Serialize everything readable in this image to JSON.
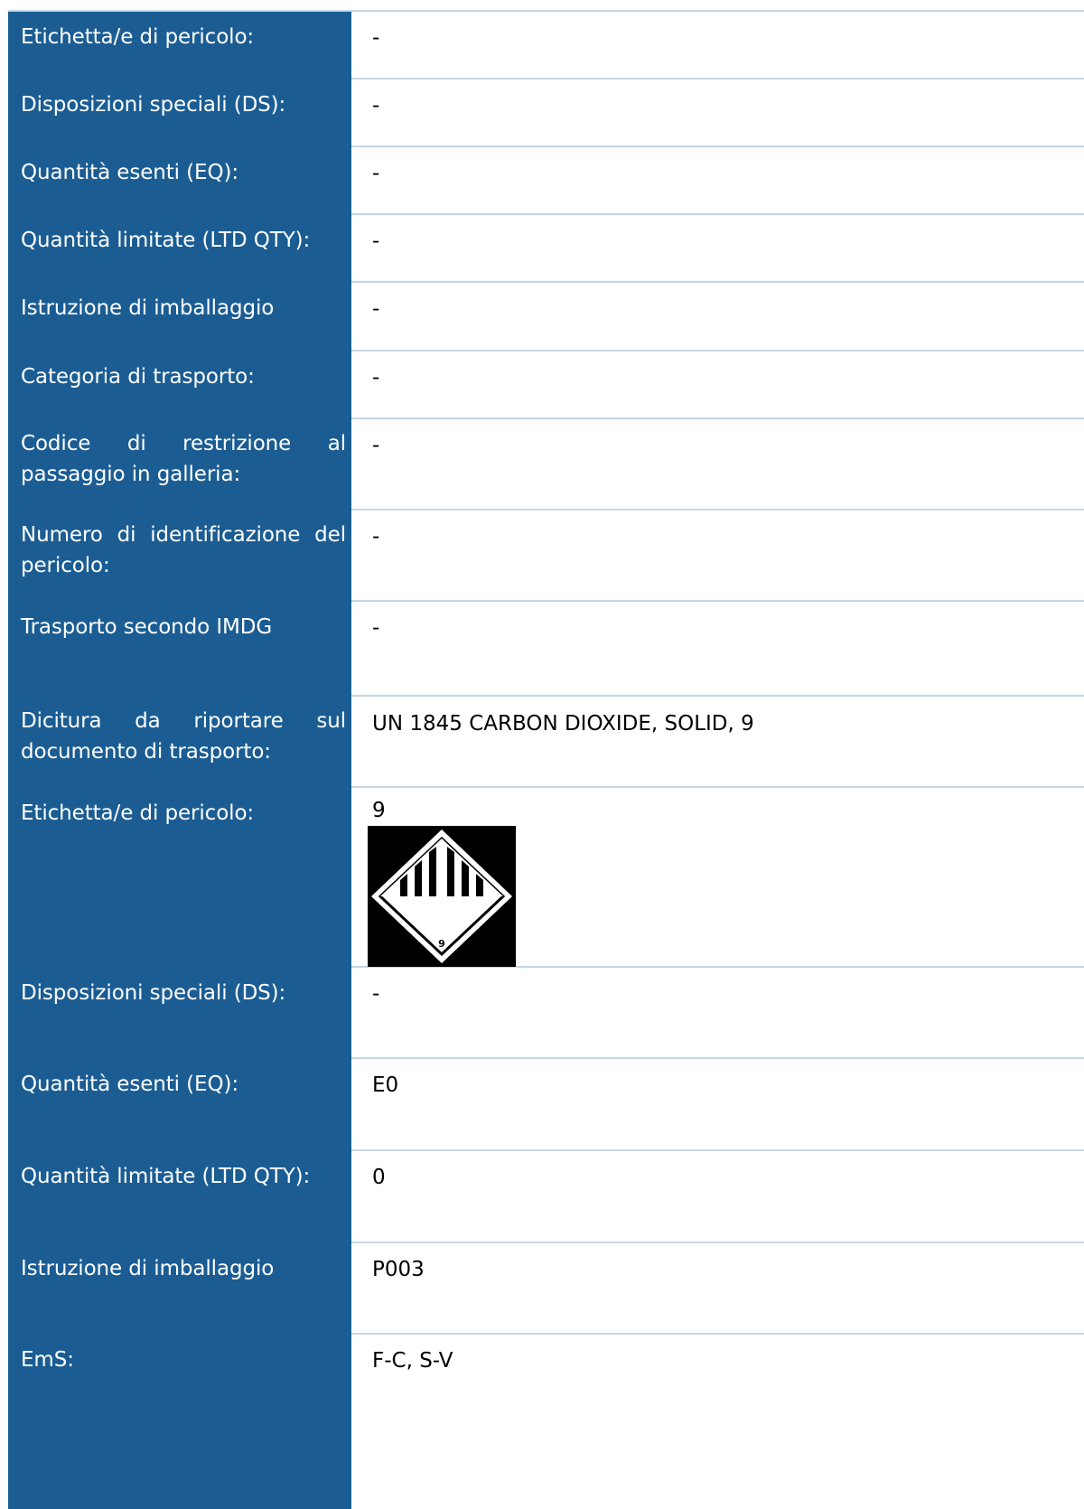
{
  "rows": [
    {
      "label": "Etichetta/e di pericolo:",
      "value": "-"
    },
    {
      "label": "Disposizioni speciali (DS):",
      "value": "-"
    },
    {
      "label": "Quantità esenti (EQ):",
      "value": "-"
    },
    {
      "label": "Quantità limitate (LTD QTY):",
      "value": "-"
    },
    {
      "label": "Istruzione di imballaggio",
      "value": "-"
    },
    {
      "label": "Categoria di trasporto:",
      "value": "-"
    },
    {
      "label": "Codice di restrizione al passaggio in galleria:",
      "value": "-"
    },
    {
      "label": "Numero di identificazione del pericolo:",
      "value": "-"
    },
    {
      "label": "Trasporto secondo IMDG",
      "value": "-"
    },
    {
      "label": "Dicitura da riportare sul documento di trasporto:",
      "value": "UN 1845 CARBON DIOXIDE, SOLID, 9"
    },
    {
      "label": "Etichetta/e di pericolo:",
      "value": "9",
      "image_text": "9",
      "image": "class-9-hazard-label-icon"
    },
    {
      "label": "Disposizioni speciali (DS):",
      "value": "-"
    },
    {
      "label": "Quantità esenti (EQ):",
      "value": "E0"
    },
    {
      "label": "Quantità limitate (LTD QTY):",
      "value": "0"
    },
    {
      "label": "Istruzione di imballaggio",
      "value": "P003"
    },
    {
      "label": "EmS:",
      "value": "F-C, S-V"
    }
  ],
  "colors": {
    "label_bg": "#1b5d93",
    "label_text": "#ffffff",
    "divider": "#c4d6e4"
  }
}
